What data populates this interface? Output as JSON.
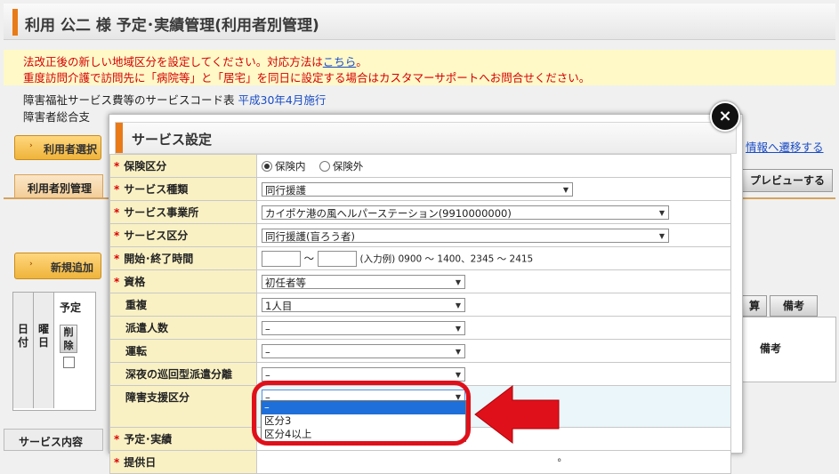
{
  "header": {
    "title": "利用 公二 様 予定･実績管理(利用者別管理)"
  },
  "notice": {
    "line1_text": "法改正後の新しい地域区分を設定してください。対応方法は",
    "line1_link": "こちら",
    "line1_end": "。",
    "line2": "重度訪問介護で訪問先に「病院等」と「居宅」を同日に設定する場合はカスタマーサポートへお問合せください。"
  },
  "background": {
    "service_code_text": "障害福祉サービス費等のサービスコード表",
    "service_code_link": "平成30年4月施行",
    "line2_partial": "障害者総合支",
    "user_select_btn": "利用者選択",
    "user_mgmt_tab": "利用者別管理",
    "new_add_btn": "新規追加",
    "date_header": "日付",
    "weekday_header": "曜日",
    "plan_header": "予定",
    "delete_label": "削除",
    "service_content": "サービス内容",
    "info_link": "情報へ遷移する",
    "preview_btn": "プレビューする",
    "calc_header": "算",
    "remarks_header": "備考",
    "remarks_col": "備考"
  },
  "modal": {
    "title": "サービス設定",
    "close_icon": "close-icon",
    "rows": [
      {
        "label": "保険区分",
        "required": true
      },
      {
        "label": "サービス種類",
        "required": true
      },
      {
        "label": "サービス事業所",
        "required": true
      },
      {
        "label": "サービス区分",
        "required": true
      },
      {
        "label": "開始･終了時間",
        "required": true
      },
      {
        "label": "資格",
        "required": true
      },
      {
        "label": "重複",
        "required": false
      },
      {
        "label": "派遣人数",
        "required": false
      },
      {
        "label": "運転",
        "required": false
      },
      {
        "label": "深夜の巡回型派遣分離",
        "required": false
      },
      {
        "label": "障害支援区分",
        "required": false
      },
      {
        "label": "予定･実績",
        "required": true
      },
      {
        "label": "提供日",
        "required": true
      }
    ],
    "insurance": {
      "option_in": "保険内",
      "option_out": "保険外",
      "selected": "保険内"
    },
    "service_type": "同行援護",
    "office": "カイポケ港の風ヘルパーステーション(9910000000)",
    "service_category": "同行援護(盲ろう者)",
    "time": {
      "separator": "〜",
      "example": "(入力例) 0900 〜 1400、2345 〜 2415"
    },
    "qualification": "初任者等",
    "duplicate": "1人目",
    "dispatch": "–",
    "driving": "–",
    "night_patrol": "–",
    "disability_class": {
      "value": "–",
      "options": [
        "–",
        "区分3",
        "区分4以上"
      ],
      "highlighted": "–"
    },
    "trailing_dot": "。"
  },
  "colors": {
    "accent_orange": "#e97a18",
    "notice_red": "#d40000",
    "annotation_red": "#e0101a",
    "label_bg": "#f9f1c4"
  }
}
